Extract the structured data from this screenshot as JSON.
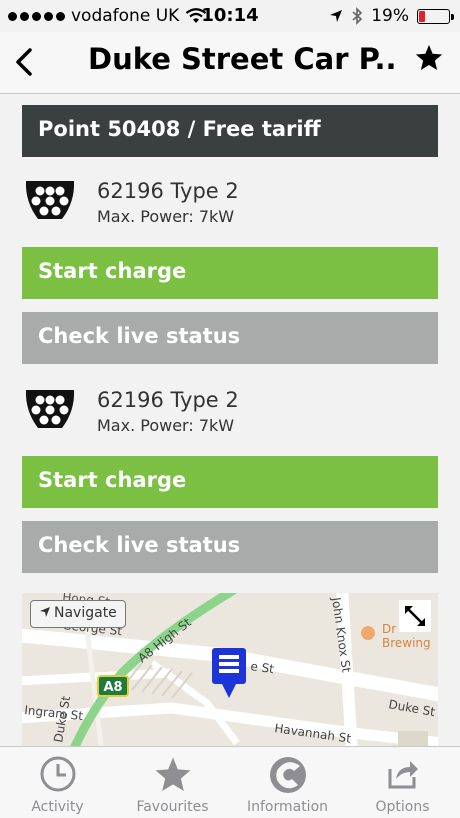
{
  "status_bar": {
    "carrier": "vodafone UK",
    "time": "10:14",
    "battery_percent": "19%",
    "battery_level": 0.19,
    "battery_color": "#e0222a"
  },
  "nav": {
    "title": "Duke Street Car P..."
  },
  "point": {
    "header": "Point 50408 / Free tariff"
  },
  "connectors": [
    {
      "title": "62196 Type 2",
      "power": "Max. Power: 7kW",
      "start_label": "Start charge",
      "status_label": "Check live status"
    },
    {
      "title": "62196 Type 2",
      "power": "Max. Power: 7kW",
      "start_label": "Start charge",
      "status_label": "Check live status"
    }
  ],
  "map": {
    "navigate_label": "Navigate",
    "streets": [
      "George St",
      "A8 High St",
      "John Knox St",
      "Duke St",
      "Havannah St",
      "Ingram St",
      "Duke St"
    ],
    "route_badge": "A8",
    "poi_label": "Drygate Brewing"
  },
  "tabs": [
    {
      "label": "Activity",
      "icon": "clock-icon"
    },
    {
      "label": "Favourites",
      "icon": "star-icon"
    },
    {
      "label": "Information",
      "icon": "info-c-icon"
    },
    {
      "label": "Options",
      "icon": "share-icon"
    }
  ],
  "colors": {
    "header_dark": "#3a3f40",
    "start_green": "#7bc043",
    "status_grey": "#a9abaa",
    "map_marker": "#1d35d8",
    "road_green": "#8bd48a"
  }
}
